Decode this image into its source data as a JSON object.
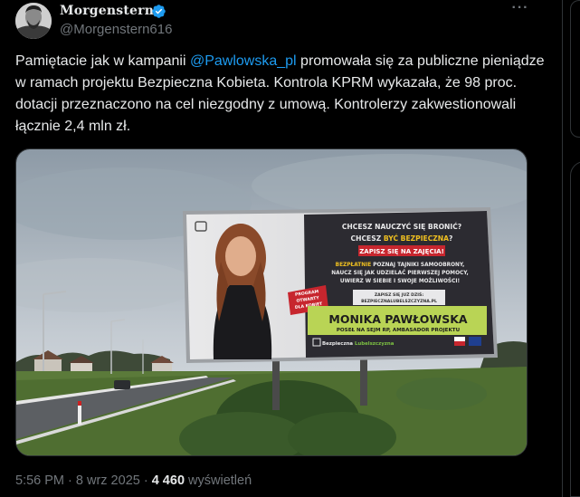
{
  "author": {
    "display_name": "Morgenstern",
    "handle": "@Morgenstern616",
    "verified": true
  },
  "tweet": {
    "text_before": "Pamiętacie jak w kampanii ",
    "mention": "@Pawlowska_pl",
    "text_after": " promowała się za publiczne pieniądze w ramach projektu Bezpieczna Kobieta. Kontrola KPRM wykazała, że 98 proc. dotacji przeznaczono na cel niezgodny z umową. Kontrolerzy zakwestionowali łącznie 2,4 mln zł."
  },
  "billboard": {
    "q1": "CHCESZ NAUCZYĆ SIĘ BRONIĆ?",
    "q2_a": "CHCESZ ",
    "q2_b": "BYĆ BEZPIECZNA",
    "q2_c": "?",
    "cta": "ZAPISZ SIĘ NA ZAJĘCIA!",
    "line1_a": "BEZPŁATNIE",
    "line1_b": " POZNAJ TAJNIKI SAMOOBRONY,",
    "line2": "NAUCZ SIĘ JAK UDZIELAĆ PIERWSZEJ POMOCY,",
    "line3": "UWIERZ W SIEBIE I SWOJE MOŻLIWOŚCI!",
    "signup": "ZAPISZ SIĘ JUŻ DZIŚ:",
    "site": "BEZPIECZNALUBELSZCZYZNA.PL",
    "name": "MONIKA PAWŁOWSKA",
    "title": "POSEŁ NA SEJM RP, AMBASADOR PROJEKTU",
    "badge1": "PROGRAM",
    "badge2": "OTWARTY",
    "badge3": "DLA KOBIET",
    "logo_a": "Bezpieczna ",
    "logo_b": "Lubelszczyzna"
  },
  "meta": {
    "time": "5:56 PM",
    "separator": " · ",
    "date": "8 wrz 2025",
    "views_count": "4 460",
    "views_label": " wyświetleń"
  },
  "icons": {
    "more": "more-icon",
    "verified": "verified-badge-icon"
  },
  "colors": {
    "accent": "#1d9bf0",
    "text": "#e7e9ea",
    "muted": "#71767b",
    "background": "#000000"
  }
}
